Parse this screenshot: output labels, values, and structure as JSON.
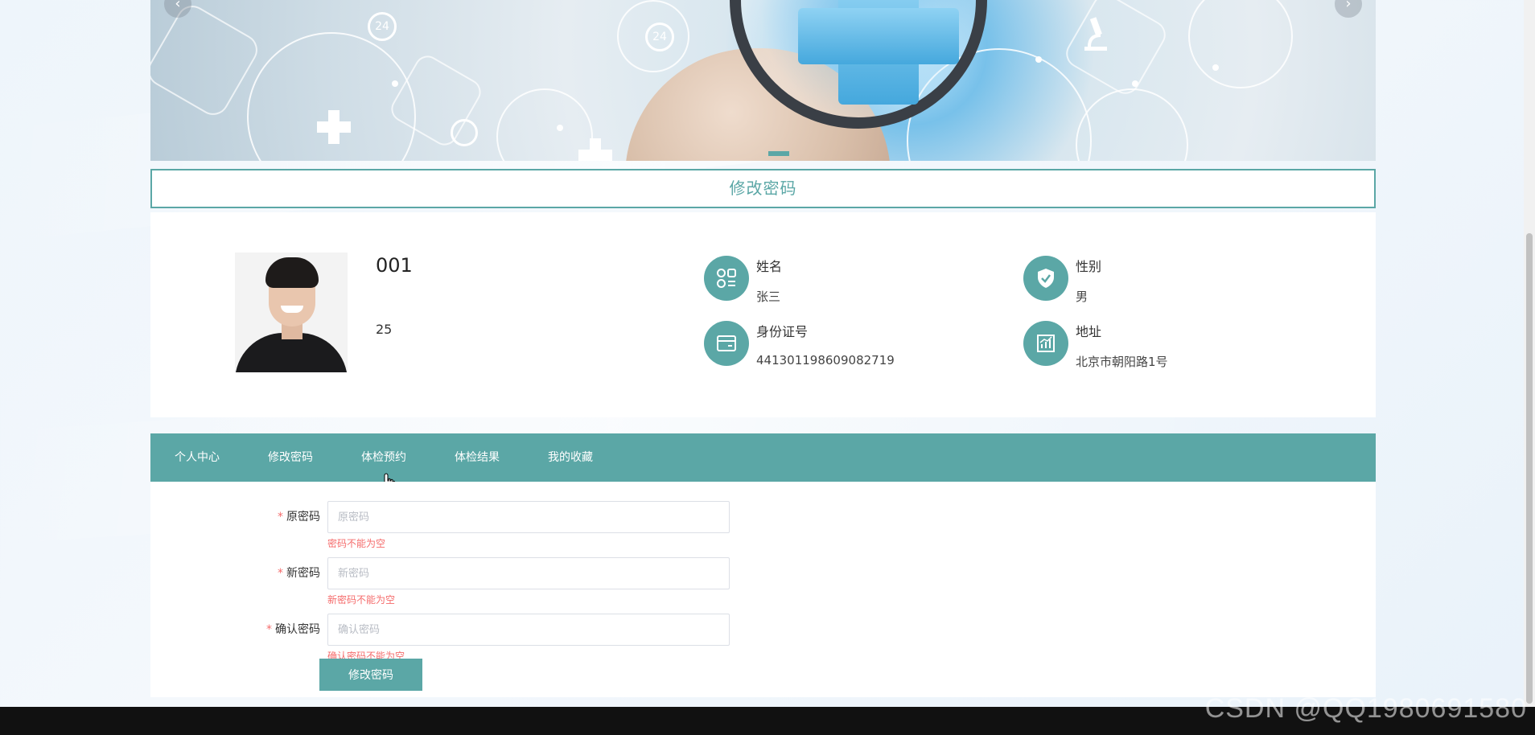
{
  "watermark": "CSDN @QQ1980691580",
  "banner": {
    "prev_icon": "‹",
    "next_icon": "›",
    "glyphs": [
      "24",
      "24"
    ]
  },
  "page_title": "修改密码",
  "profile": {
    "username": "001",
    "age": "25",
    "fields": [
      {
        "label": "姓名",
        "value": "张三",
        "icon": "grid-icon"
      },
      {
        "label": "性别",
        "value": "男",
        "icon": "shield-check-icon"
      },
      {
        "label": "身份证号",
        "value": "441301198609082719",
        "icon": "wallet-card-icon"
      },
      {
        "label": "地址",
        "value": "北京市朝阳路1号",
        "icon": "chart-icon"
      }
    ]
  },
  "tabs": [
    {
      "label": "个人中心"
    },
    {
      "label": "修改密码"
    },
    {
      "label": "体检预约"
    },
    {
      "label": "体检结果"
    },
    {
      "label": "我的收藏"
    }
  ],
  "form": {
    "required_mark": "*",
    "fields": [
      {
        "label": "原密码",
        "placeholder": "原密码",
        "value": "",
        "error": "密码不能为空"
      },
      {
        "label": "新密码",
        "placeholder": "新密码",
        "value": "",
        "error": "新密码不能为空"
      },
      {
        "label": "确认密码",
        "placeholder": "确认密码",
        "value": "",
        "error": "确认密码不能为空"
      }
    ],
    "submit_label": "修改密码"
  },
  "colors": {
    "accent": "#5ba7a6",
    "error": "#f56c6c"
  }
}
